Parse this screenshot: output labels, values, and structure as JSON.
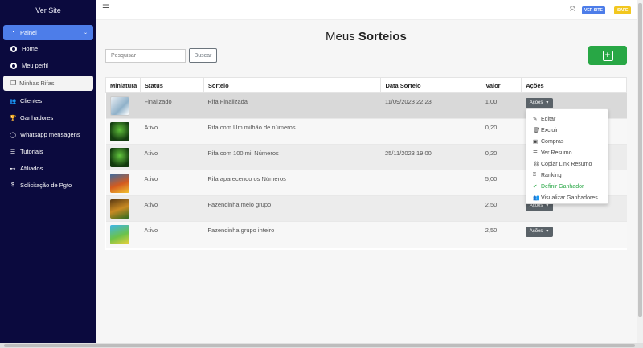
{
  "sidebar": {
    "brand": "Ver Site",
    "panel": {
      "label": "Painel",
      "icon": "dashboard-icon"
    },
    "panel_sub": [
      {
        "label": "Home",
        "icon": "circle-icon"
      },
      {
        "label": "Meu perfil",
        "icon": "circle-icon"
      },
      {
        "label": "Minhas Rifas",
        "icon": "copy-icon"
      }
    ],
    "items": [
      {
        "label": "Clientes",
        "icon": "users-icon"
      },
      {
        "label": "Ganhadores",
        "icon": "trophy-icon"
      },
      {
        "label": "Whatsapp mensagens",
        "icon": "whatsapp-icon"
      },
      {
        "label": "Tutoriais",
        "icon": "list-icon"
      },
      {
        "label": "Afiliados",
        "icon": "dumbbell-icon"
      },
      {
        "label": "Solicitação de Pgto",
        "icon": "dollar-icon"
      }
    ]
  },
  "topbar": {
    "site_badge": "VER SITE",
    "safe_badge": "SAFE"
  },
  "page": {
    "title_light": "Meus",
    "title_bold": "Sorteios"
  },
  "search": {
    "placeholder": "Pesquisar",
    "button": "Buscar"
  },
  "table": {
    "headers": [
      "Miniatura",
      "Status",
      "Sorteio",
      "Data Sorteio",
      "Valor",
      "Ações"
    ],
    "rows": [
      {
        "status": "Finalizado",
        "name": "Rifa Finalizada",
        "date": "11/09/2023 22:23",
        "value": "1,00"
      },
      {
        "status": "Ativo",
        "name": "Rifa com Um milhão de números",
        "date": "",
        "value": "0,20"
      },
      {
        "status": "Ativo",
        "name": "Rifa com 100 mil Números",
        "date": "25/11/2023 19:00",
        "value": "0,20"
      },
      {
        "status": "Ativo",
        "name": "Rifa aparecendo os Números",
        "date": "",
        "value": "5,00"
      },
      {
        "status": "Ativo",
        "name": "Fazendinha meio grupo",
        "date": "",
        "value": "2,50"
      },
      {
        "status": "Ativo",
        "name": "Fazendinha grupo inteiro",
        "date": "",
        "value": "2,50"
      }
    ],
    "actions_label": "Ações"
  },
  "dropdown": [
    {
      "label": "Editar",
      "icon": "pencil-icon"
    },
    {
      "label": "Excluir",
      "icon": "trash-icon"
    },
    {
      "label": "Compras",
      "icon": "bag-icon"
    },
    {
      "label": "Ver Resumo",
      "icon": "list-icon"
    },
    {
      "label": "Copiar Link Resumo",
      "icon": "link-icon"
    },
    {
      "label": "Ranking",
      "icon": "medal-icon"
    },
    {
      "label": "Definir Ganhador",
      "icon": "check-icon"
    },
    {
      "label": "Visualizar Ganhadores",
      "icon": "users-icon"
    }
  ],
  "colors": {
    "sidebar": "#0b0a3e",
    "accent": "#4d7de9",
    "success": "#28a745",
    "warning": "#f2c71f"
  }
}
